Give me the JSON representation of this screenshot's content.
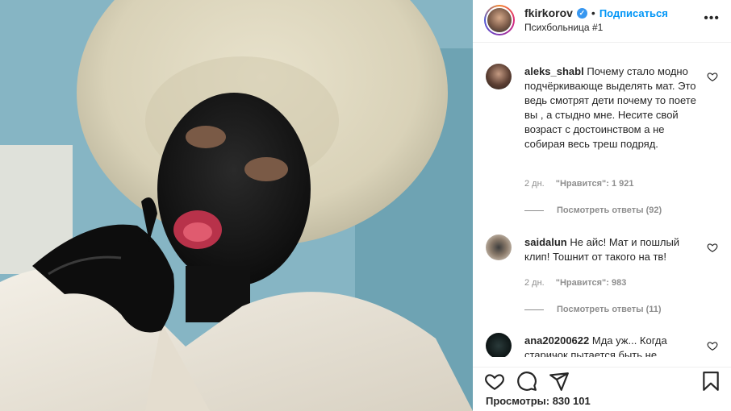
{
  "header": {
    "username": "fkirkorov",
    "separator": "•",
    "follow_label": "Подписаться",
    "subtitle": "Психбольница #1",
    "more_label": "•••"
  },
  "comments": [
    {
      "username": "aleks_shabl",
      "text": "Почему стало модно подчёркивающе выделять мат. Это ведь смотрят дети почему то поете вы , а стыдно мне. Несите свой возраст с достоинством а не собирая весь треш подряд.",
      "time": "2 дн.",
      "likes": "\"Нравится\": 1 921",
      "replies": "Посмотреть ответы (92)"
    },
    {
      "username": "saidalun",
      "text": "Не айс! Мат и пошлый клип! Тошнит от такого на тв!",
      "time": "2 дн.",
      "likes": "\"Нравится\": 983",
      "replies": "Посмотреть ответы (11)"
    },
    {
      "username": "ana20200622",
      "text": "Мда уж... Когда старичок пытается быть не"
    }
  ],
  "footer": {
    "views": "Просмотры: 830 101"
  },
  "icons": {
    "like": "heart-icon",
    "comment": "comment-bubble-icon",
    "share": "paper-plane-icon",
    "save": "bookmark-icon"
  },
  "colors": {
    "accent": "#0095f6",
    "verified": "#3897f0",
    "muted": "#8e8e8e"
  }
}
